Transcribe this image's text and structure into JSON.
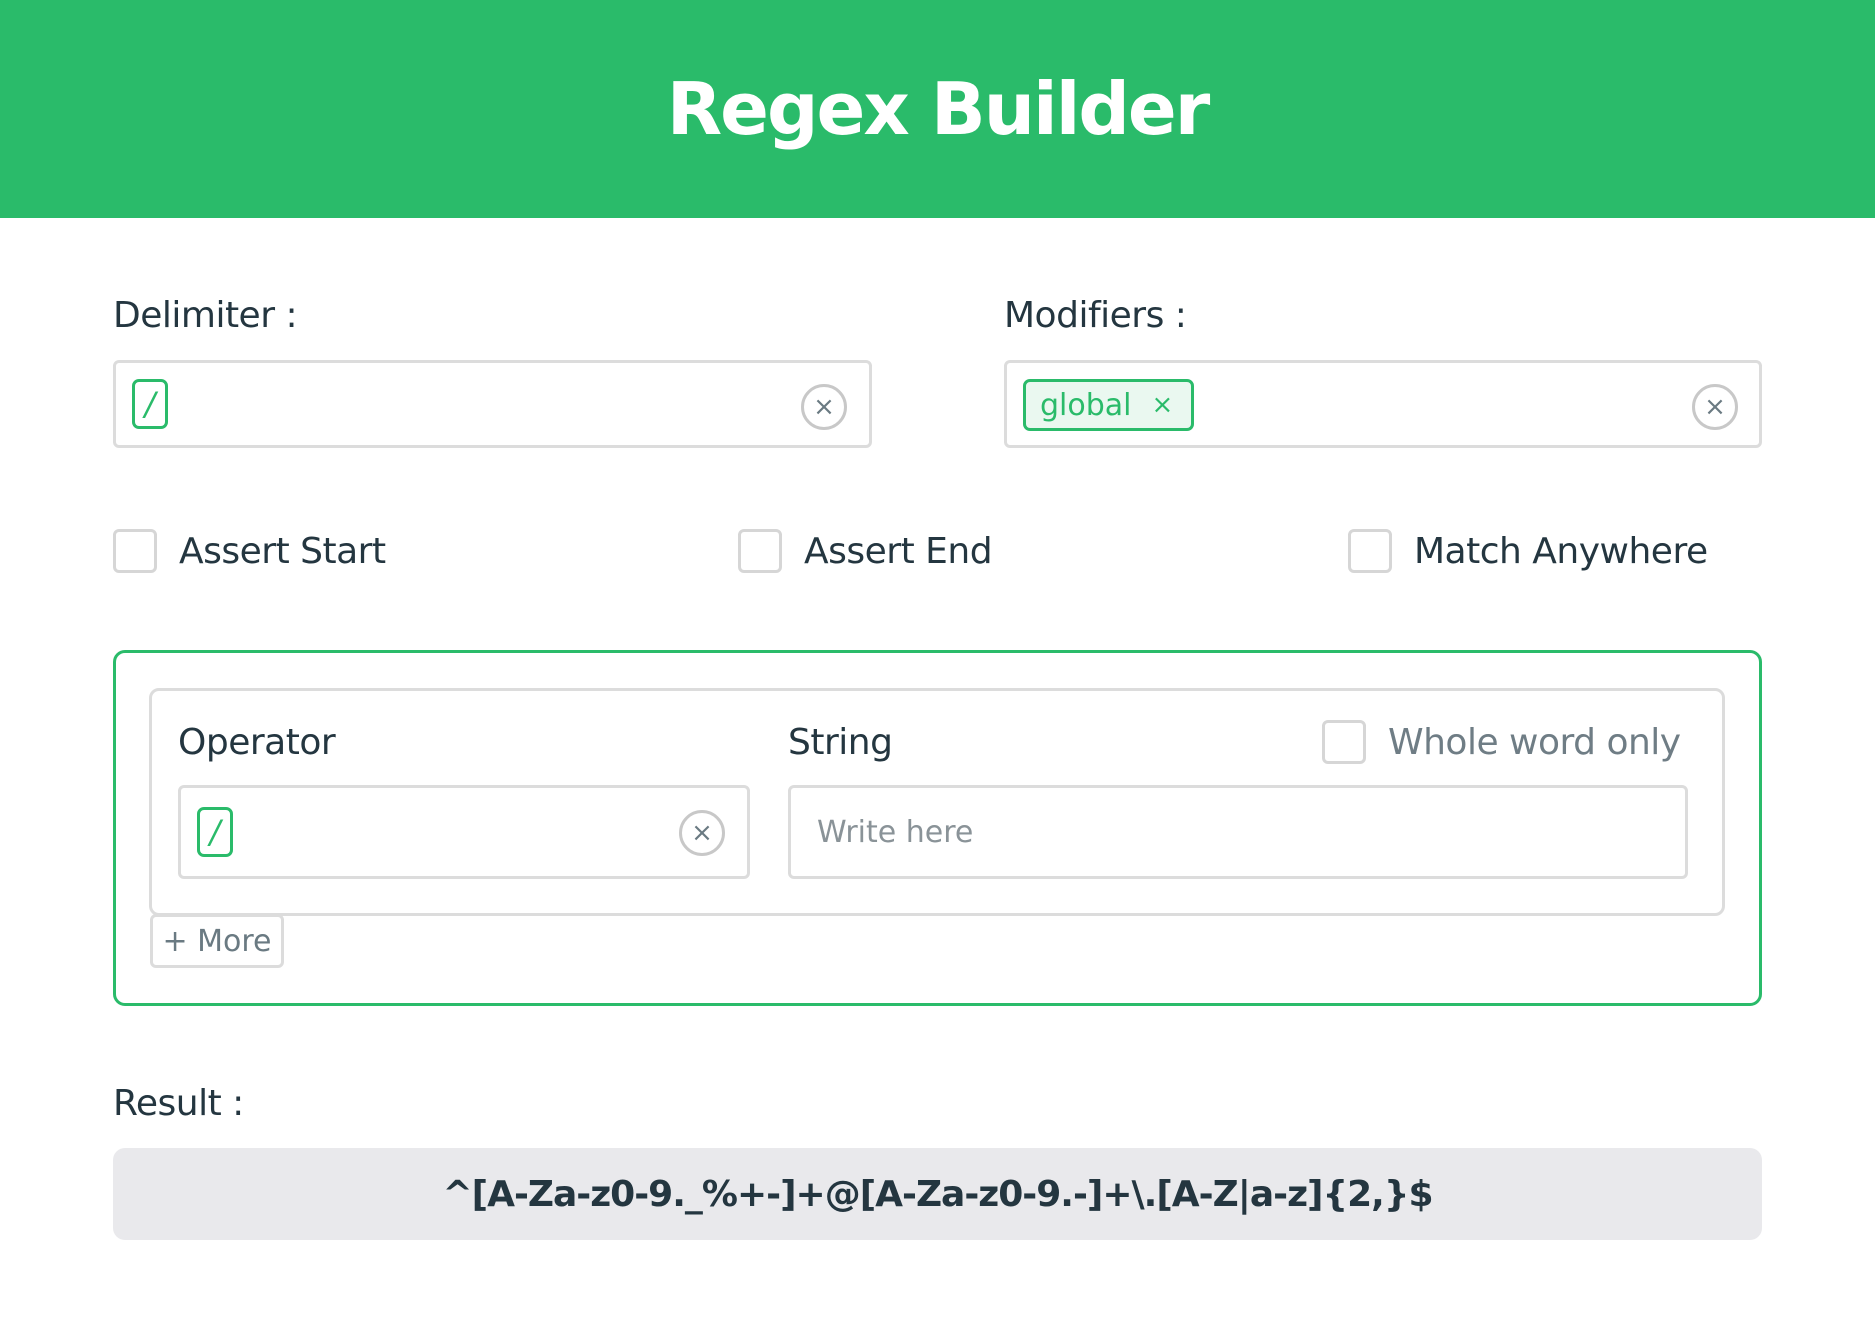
{
  "header": {
    "title": "Regex Builder"
  },
  "delimiter": {
    "label": "Delimiter :",
    "value": "/",
    "clear_icon": "×"
  },
  "modifiers": {
    "label": "Modifiers :",
    "chips": [
      {
        "label": "global",
        "remove_icon": "×"
      }
    ],
    "clear_icon": "×"
  },
  "options": [
    {
      "label": "Assert Start",
      "checked": false
    },
    {
      "label": "Assert End",
      "checked": false
    },
    {
      "label": "Match Anywhere",
      "checked": false
    }
  ],
  "rule": {
    "operator_label": "Operator",
    "operator_value": "/",
    "operator_clear_icon": "×",
    "string_label": "String",
    "string_placeholder": "Write here",
    "whole_word_label": "Whole word only",
    "whole_word_checked": false
  },
  "more_button": "+ More",
  "result": {
    "label": "Result :",
    "value": "^[A-Za-z0-9._%+-]+@[A-Za-z0-9.-]+\\.[A-Z|a-z]{2,}$"
  },
  "colors": {
    "accent": "#2abb6a",
    "text": "#243640",
    "border": "#dcdcdc",
    "result_bg": "#e9e9ec"
  },
  "icons": {
    "clear": "close-circle-icon",
    "chip_remove": "close-icon"
  }
}
